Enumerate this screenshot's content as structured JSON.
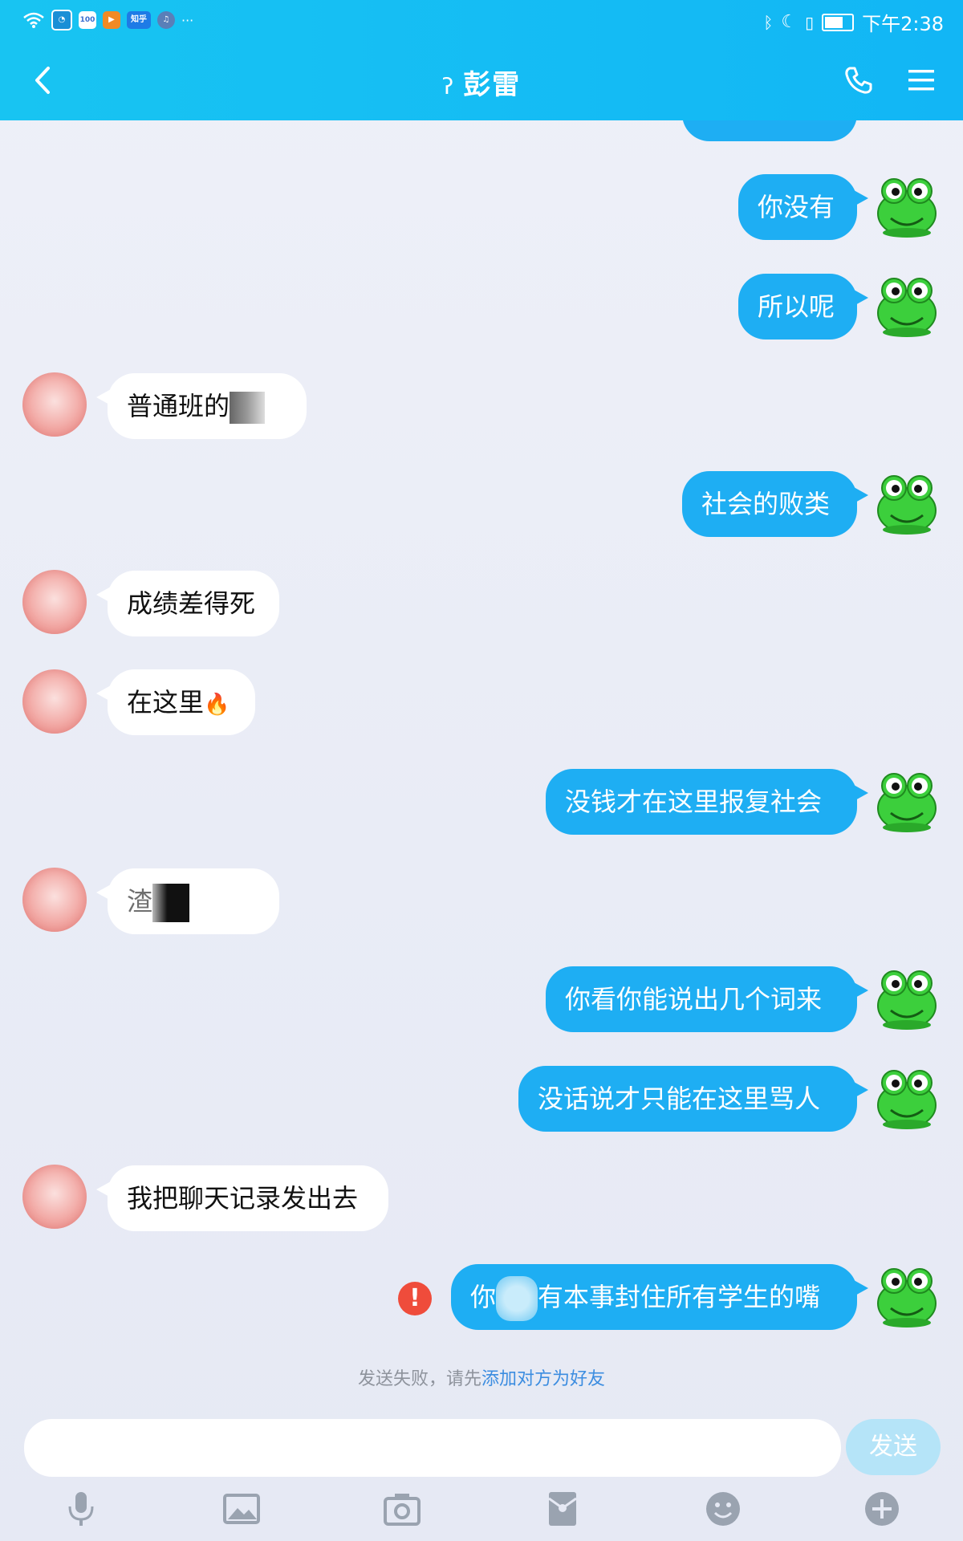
{
  "status_bar": {
    "app_icons": [
      "wifi-icon",
      "qq-browser-icon",
      "100-app-icon",
      "qq-live-icon",
      "zhihu-icon",
      "music-icon",
      "more-dots-icon"
    ],
    "zhihu_text": "知乎",
    "time": "下午2:38"
  },
  "header": {
    "title": "彭雷",
    "ear_glyph": "ʔ"
  },
  "messages": [
    {
      "side": "out",
      "text": "你没有"
    },
    {
      "side": "out",
      "text": "所以呢"
    },
    {
      "side": "in",
      "text": "普通班的"
    },
    {
      "side": "out",
      "text": "社会的败类"
    },
    {
      "side": "in",
      "text": "成绩差得死"
    },
    {
      "side": "in",
      "text": "在这里"
    },
    {
      "side": "out",
      "text": "没钱才在这里报复社会"
    },
    {
      "side": "in",
      "text": "渣"
    },
    {
      "side": "out",
      "text": "你看你能说出几个词来"
    },
    {
      "side": "out",
      "text": "没话说才只能在这里骂人"
    },
    {
      "side": "in",
      "text": "我把聊天记录发出去"
    },
    {
      "side": "out",
      "text_a": "你",
      "text_b": "有本事封住所有学生的嘴",
      "failed": true
    }
  ],
  "fire_emoji": "🔥",
  "fail_tip": {
    "prefix": "发送失败，请先",
    "link": "添加对方为好友"
  },
  "input": {
    "value": "",
    "send_label": "发送"
  },
  "toolbar": [
    "voice-icon",
    "image-icon",
    "camera-icon",
    "red-packet-icon",
    "emoji-icon",
    "plus-icon"
  ],
  "colors": {
    "header": "#12b6f5",
    "bubble_out": "#1eaef3",
    "bubble_in": "#ffffff",
    "fail": "#ef4c3b",
    "link": "#3c8de0"
  }
}
